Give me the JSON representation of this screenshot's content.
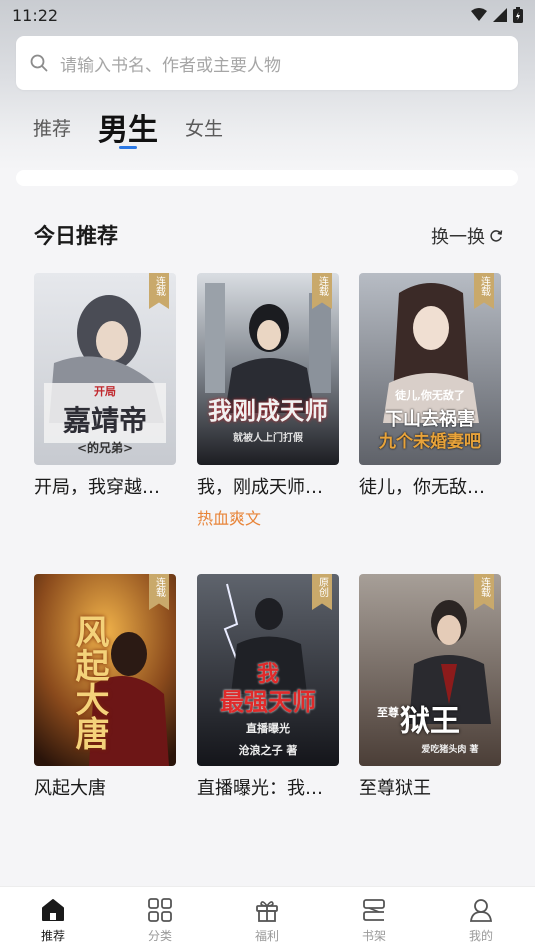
{
  "status_bar": {
    "time": "11:22"
  },
  "search": {
    "placeholder": "请输入书名、作者或主要人物"
  },
  "tabs": [
    {
      "label": "推荐"
    },
    {
      "label": "男生"
    },
    {
      "label": "女生"
    }
  ],
  "section": {
    "title": "今日推荐",
    "refresh_label": "换一换"
  },
  "books": [
    {
      "title": "开局，我穿越…",
      "badge": "连载",
      "cover_lines": [
        "开局",
        "嘉靖帝",
        "<的兄弟>"
      ],
      "tag": ""
    },
    {
      "title": "我，刚成天师…",
      "badge": "连载",
      "cover_lines": [
        "我刚成天师",
        "就被人上门打假"
      ],
      "tag": "热血爽文"
    },
    {
      "title": "徒儿，你无敌…",
      "badge": "连载",
      "cover_lines": [
        "徒儿,你无敌了",
        "下山去祸害",
        "九个未婚妻吧"
      ],
      "tag": ""
    },
    {
      "title": "风起大唐",
      "badge": "连载",
      "cover_lines": [
        "风起大唐"
      ],
      "tag": ""
    },
    {
      "title": "直播曝光：我…",
      "badge": "原创",
      "cover_lines": [
        "我",
        "最强天师",
        "直播曝光",
        "沧浪之子 著"
      ],
      "tag": ""
    },
    {
      "title": "至尊狱王",
      "badge": "连载",
      "cover_lines": [
        "至尊",
        "狱王",
        "爱吃猪头肉 著"
      ],
      "tag": ""
    }
  ],
  "nav": [
    {
      "label": "推荐",
      "icon": "home-icon",
      "active": true
    },
    {
      "label": "分类",
      "icon": "grid-icon",
      "active": false
    },
    {
      "label": "福利",
      "icon": "gift-icon",
      "active": false
    },
    {
      "label": "书架",
      "icon": "bookshelf-icon",
      "active": false
    },
    {
      "label": "我的",
      "icon": "profile-icon",
      "active": false
    }
  ],
  "colors": {
    "accent": "#2b78e4",
    "tag": "#e8853a",
    "ribbon": "#c9a96b"
  }
}
